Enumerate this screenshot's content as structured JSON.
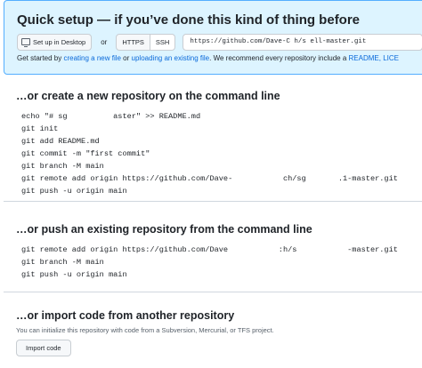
{
  "quick_setup": {
    "title": "Quick setup — if you’ve done this kind of thing before",
    "desktop_button": "Set up in Desktop",
    "or": "or",
    "https_tab": "HTTPS",
    "ssh_tab": "SSH",
    "clone_url": "https://github.com/Dave-C          h/s    ell-master.git",
    "desc_prefix": "Get started by ",
    "create_link": "creating a new file",
    "desc_mid": " or ",
    "upload_link": "uploading an existing file",
    "desc_suffix": ". We recommend every repository include a ",
    "readme_link": "README",
    "desc_tail": ", LICE"
  },
  "create_section": {
    "heading": "…or create a new repository on the command line",
    "lines": [
      "echo \"# sg          aster\" >> README.md",
      "git init",
      "git add README.md",
      "git commit -m \"first commit\"",
      "git branch -M main",
      "git remote add origin https://github.com/Dave-           ch/sg       .1-master.git",
      "git push -u origin main"
    ]
  },
  "push_section": {
    "heading": "…or push an existing repository from the command line",
    "lines": [
      "git remote add origin https://github.com/Dave           :h/s           -master.git",
      "git branch -M main",
      "git push -u origin main"
    ]
  },
  "import_section": {
    "heading": "…or import code from another repository",
    "description": "You can initialize this repository with code from a Subversion, Mercurial, or TFS project.",
    "button": "Import code"
  },
  "colors": {
    "setup_bg": "#ddf4ff",
    "setup_border": "#54aeff",
    "link": "#0969da"
  }
}
